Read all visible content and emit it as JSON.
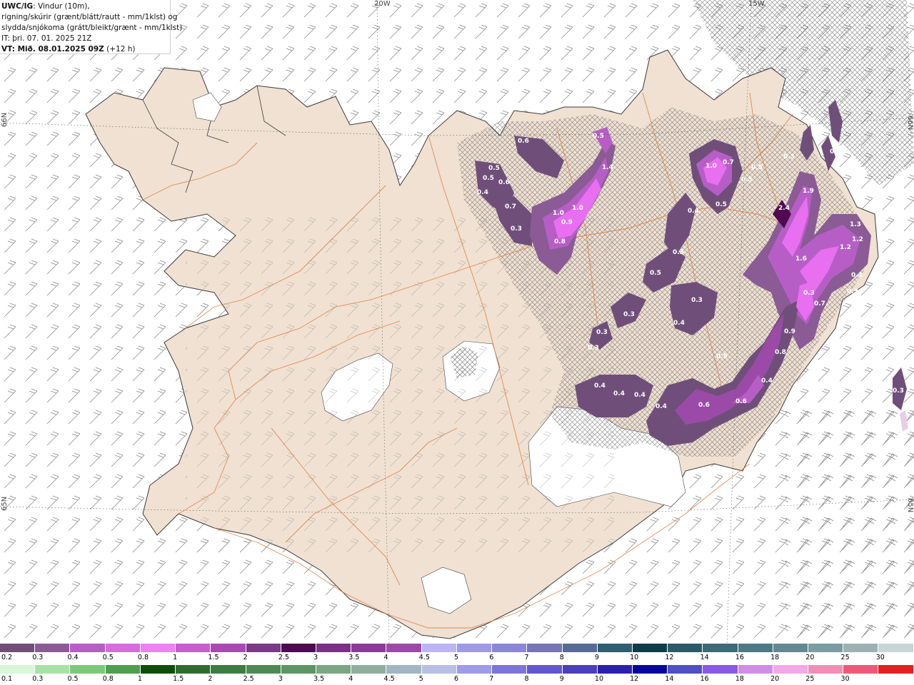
{
  "title": {
    "product_code": "UWC/IG",
    "line1_rest": ": Vindur (10m),",
    "line2": "rigning/skúrir (grænt/blátt/rautt - mm/1klst) og",
    "line3": "slydda/snjókoma (grátt/bleikt/grænt - mm/1klst)",
    "initial_time": "IT: þri. 07. 01. 2025 21Z",
    "valid_time": "VT: Mið. 08.01.2025 09Z",
    "lead": " (+12 h)"
  },
  "graticule": {
    "top_20w": "20W",
    "top_15w": "15W",
    "left_66n": "66N",
    "left_65n": "65N",
    "right_66n": "66N",
    "right_65n": "65N"
  },
  "precip_labels": [
    "0.5",
    "0.6",
    "0.5",
    "0.4",
    "0.6",
    "0.7",
    "0.3",
    "1.0",
    "1.0",
    "0.9",
    "0.8",
    "1.4",
    "1.0",
    "0.7",
    "0.5",
    "0.5",
    "0.4",
    "0.5",
    "0.5",
    "0.3",
    "0.3",
    "0.5",
    "0.3",
    "0.4",
    "0.3",
    "0.3",
    "0.3",
    "2.4",
    "1.9",
    "1.6",
    "1.3",
    "1.2",
    "1.2",
    "0.4",
    "0.3",
    "0.7",
    "0.9",
    "0.8",
    "0.5",
    "0.4",
    "0.4",
    "0.4",
    "0.6",
    "0.4",
    "0.6",
    "0.3",
    "0.3",
    "0.4",
    "0.3"
  ],
  "legend_snow": {
    "colors": [
      "#6f4f7a",
      "#8a5b95",
      "#b65ec6",
      "#d86bde",
      "#f27ff5",
      "#cc5ad0",
      "#a84ab2",
      "#7a3a86",
      "#4f0a52",
      "#7a3085",
      "#8c3a98",
      "#9b4aa7",
      "#bdb4f5",
      "#9f99e7",
      "#8a87d9",
      "#7576b4",
      "#566b95",
      "#2e5f70",
      "#0d3d49",
      "#2a5a67",
      "#3c6a76",
      "#4d7985",
      "#648892",
      "#7a9ca2",
      "#9db1b3",
      "#c8d6d6"
    ],
    "ticks": [
      "0.2",
      "0.3",
      "0.4",
      "0.5",
      "0.8",
      "1",
      "1.5",
      "2",
      "2.5",
      "3",
      "3.5",
      "4",
      "4.5",
      "5",
      "6",
      "7",
      "8",
      "9",
      "10",
      "12",
      "14",
      "16",
      "18",
      "20",
      "25",
      "30"
    ]
  },
  "legend_rain": {
    "colors": [
      "#d8f7d8",
      "#a7e1a5",
      "#7cc97b",
      "#4f9f4e",
      "#0b4f0b",
      "#2d6c2e",
      "#3d7c40",
      "#4f8a54",
      "#5f9466",
      "#7aa683",
      "#8fae9c",
      "#a1b5c2",
      "#b7c0e3",
      "#9e9be8",
      "#7c76d6",
      "#6258c9",
      "#4a40b8",
      "#2b22a7",
      "#080897",
      "#5050c0",
      "#8a5be0",
      "#cf8de6",
      "#f3a8e8",
      "#f08fb6",
      "#ec5a7a",
      "#e62020"
    ],
    "ticks": [
      "0.1",
      "0.3",
      "0.5",
      "0.8",
      "1",
      "1.5",
      "2",
      "2.5",
      "3",
      "3.5",
      "4",
      "4.5",
      "5",
      "6",
      "7",
      "8",
      "9",
      "10",
      "12",
      "14",
      "16",
      "18",
      "20",
      "25",
      "30"
    ]
  },
  "colors": {
    "land": "#f0e1d2",
    "roads": "#e07a3c",
    "ice": "#ffffff",
    "snow_light": "#6f4f7a",
    "snow_mid": "#9b4aa7",
    "snow_high": "#e86ff0",
    "wind_barbs": "#8a8a8a"
  }
}
